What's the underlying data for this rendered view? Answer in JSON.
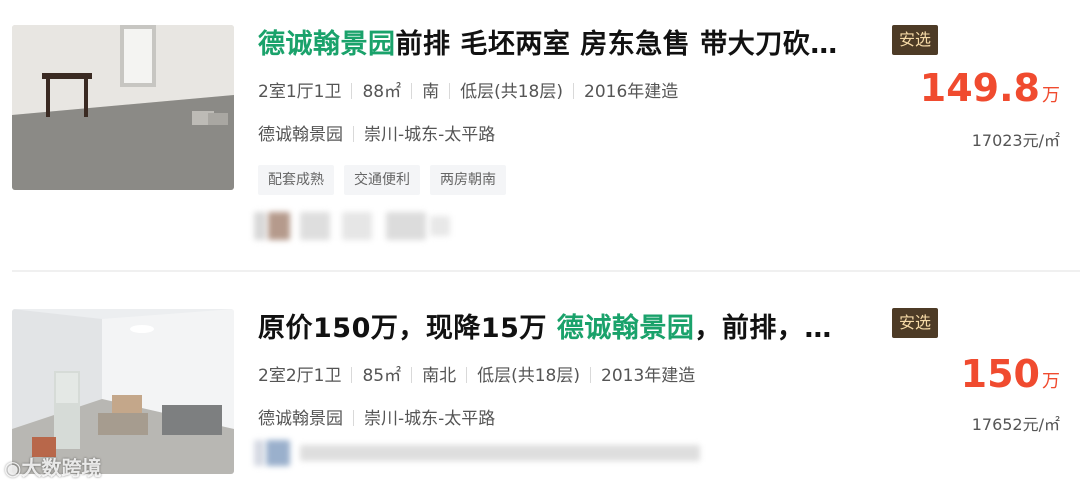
{
  "listings": [
    {
      "title_highlight": "德诚翰景园",
      "title_rest": "前排 毛坯两室 房东急售 带大刀砍…",
      "badge": "安选",
      "info": [
        "2室1厅1卫",
        "88㎡",
        "南",
        "低层(共18层)",
        "2016年建造"
      ],
      "community": "德诚翰景园",
      "area": "崇川-城东-太平路",
      "tags": [
        "配套成熟",
        "交通便利",
        "两房朝南"
      ],
      "price": "149.8",
      "price_unit": "万",
      "unit_price": "17023元/㎡"
    },
    {
      "title_prefix": "原价150万，现降15万 ",
      "title_highlight": "德诚翰景园",
      "title_rest": "，前排，…",
      "badge": "安选",
      "info": [
        "2室2厅1卫",
        "85㎡",
        "南北",
        "低层(共18层)",
        "2013年建造"
      ],
      "community": "德诚翰景园",
      "area": "崇川-城东-太平路",
      "tags": [],
      "price": "150",
      "price_unit": "万",
      "unit_price": "17652元/㎡"
    }
  ],
  "watermark": "大数跨境"
}
